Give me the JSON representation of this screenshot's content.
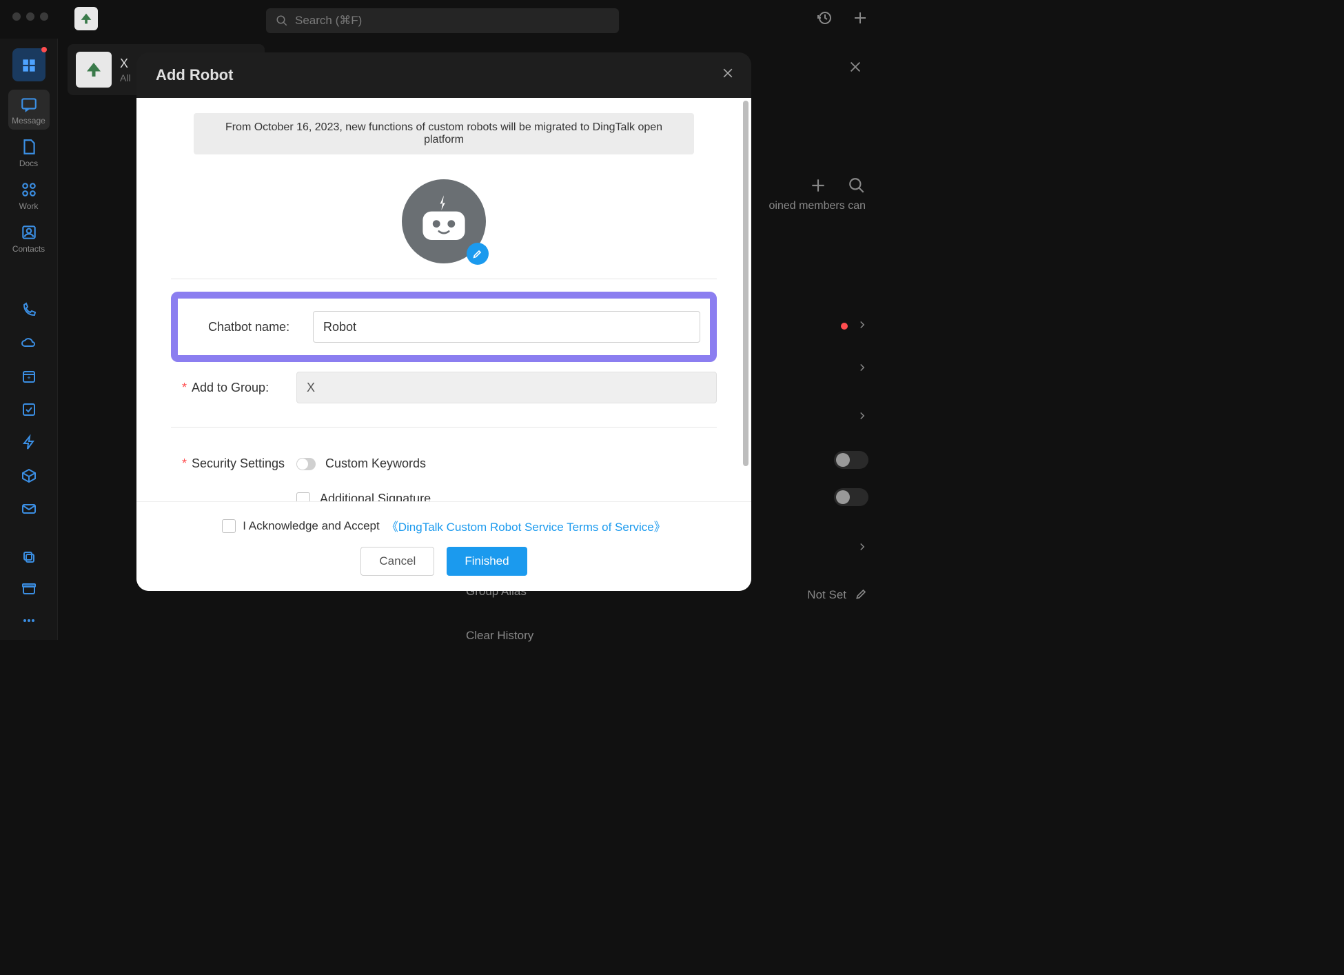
{
  "top": {
    "search_placeholder": "Search (⌘F)"
  },
  "sidebar": {
    "message": "Message",
    "docs": "Docs",
    "work": "Work",
    "contacts": "Contacts"
  },
  "conv": {
    "title": "X",
    "subtitle": "All"
  },
  "right_panel": {
    "members_hint": "oined members can",
    "group_alias": "Group Alias",
    "not_set": "Not Set",
    "clear_history": "Clear History"
  },
  "modal": {
    "title": "Add Robot",
    "announcement": "From October 16, 2023, new functions of custom robots will be migrated to DingTalk open platform",
    "chatbot_name_label": "Chatbot name:",
    "chatbot_name_value": "Robot",
    "add_to_group_label": "Add to Group:",
    "add_to_group_value": "X",
    "security_label": "Security Settings",
    "opt_custom_keywords": "Custom Keywords",
    "opt_signature": "Additional Signature",
    "ack_prefix": "I Acknowledge and Accept",
    "ack_link": "《DingTalk Custom Robot Service Terms of Service》",
    "cancel": "Cancel",
    "finished": "Finished"
  }
}
